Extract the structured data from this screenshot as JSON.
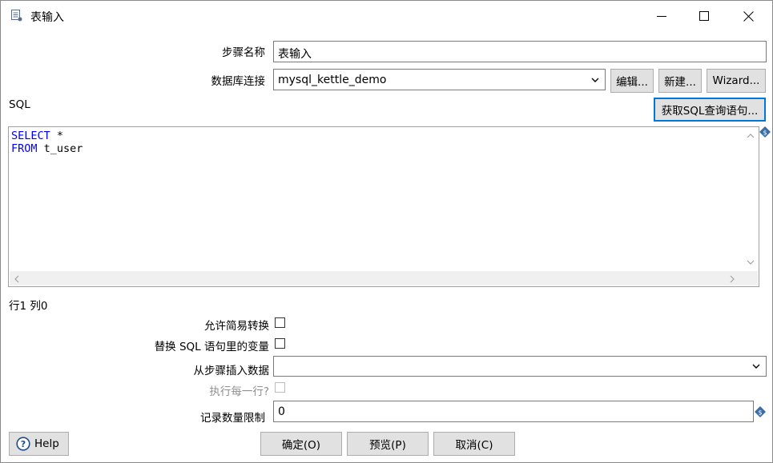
{
  "window": {
    "title": "表输入",
    "controls": {
      "minimize": "—",
      "maximize": "☐",
      "close": "✕"
    }
  },
  "form": {
    "step_name_label": "步骤名称",
    "step_name_value": "表输入",
    "db_conn_label": "数据库连接",
    "db_conn_value": "mysql_kettle_demo",
    "edit_button": "编辑...",
    "new_button": "新建...",
    "wizard_button": "Wizard...",
    "sql_label": "SQL",
    "get_sql_button": "获取SQL查询语句...",
    "sql_lines": [
      {
        "keyword": "SELECT",
        "rest": " *"
      },
      {
        "keyword": "FROM",
        "rest": " t_user"
      }
    ],
    "cursor_position": "行1 列0",
    "lazy_conversion_label": "允许简易转换",
    "lazy_conversion_checked": false,
    "replace_vars_label": "替换 SQL 语句里的变量",
    "replace_vars_checked": false,
    "insert_from_step_label": "从步骤插入数据",
    "insert_from_step_value": "",
    "execute_each_row_label": "执行每一行?",
    "execute_each_row_checked": false,
    "limit_label": "记录数量限制",
    "limit_value": "0"
  },
  "footer": {
    "help_button": "Help",
    "ok_button": "确定(O)",
    "preview_button": "预览(P)",
    "cancel_button": "取消(C)"
  },
  "colors": {
    "keyword": "#0000ff",
    "focus_border": "#0078d7",
    "variable_icon": "#3a6ea5"
  }
}
